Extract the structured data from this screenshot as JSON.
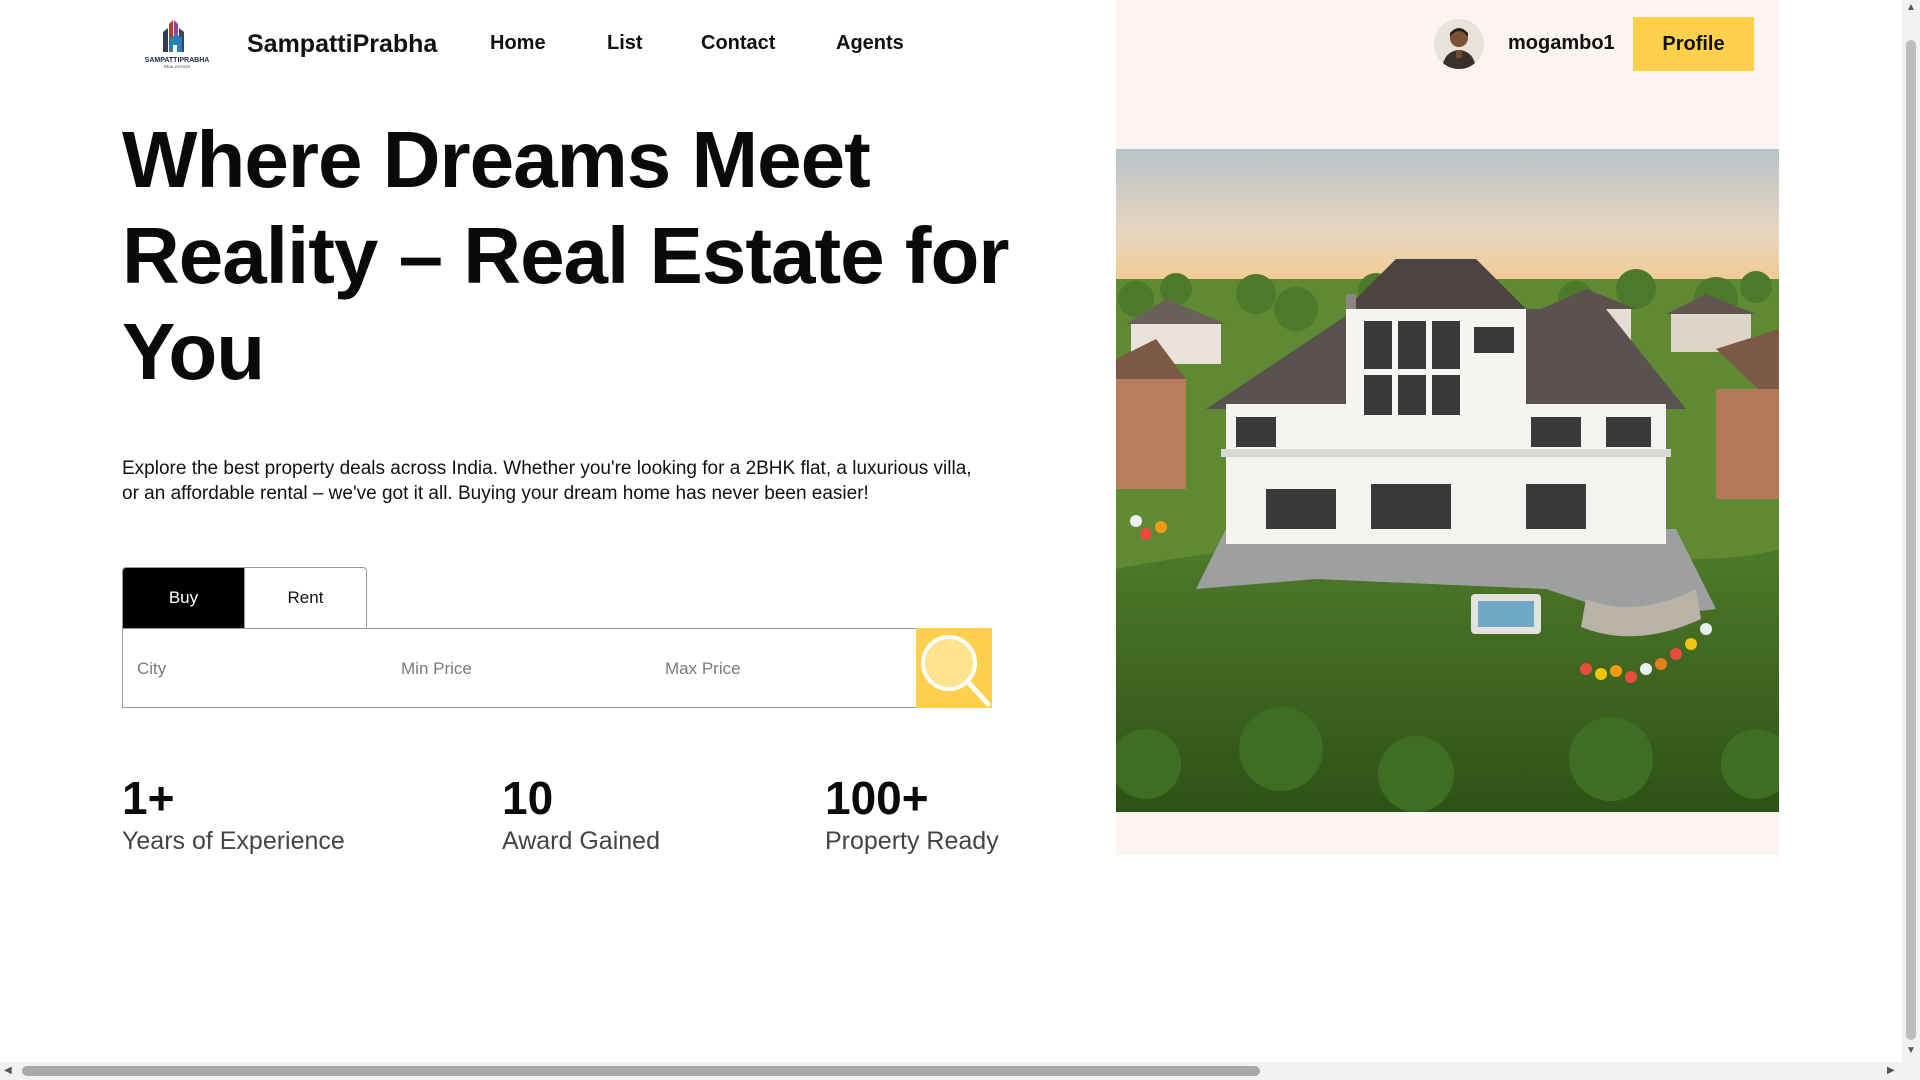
{
  "header": {
    "brand": "SampattiPrabha",
    "logo_text": "SAMPATTIPRABHA",
    "logo_subtext": "REAL ESTATE",
    "nav": [
      "Home",
      "List",
      "Contact",
      "Agents"
    ],
    "username": "mogambo1",
    "profile_label": "Profile"
  },
  "hero": {
    "title": "Where Dreams Meet Reality – Real Estate for You",
    "description": "Explore the best property deals across India. Whether you're looking for a 2BHK flat, a luxurious villa, or an affordable rental – we've got it all. Buying your dream home has never been easier!"
  },
  "search": {
    "tabs": [
      "Buy",
      "Rent"
    ],
    "active_tab": "Buy",
    "city_placeholder": "City",
    "min_price_placeholder": "Min Price",
    "max_price_placeholder": "Max Price",
    "button_icon": "search-icon"
  },
  "stats": [
    {
      "value": "1+",
      "label": "Years of Experience"
    },
    {
      "value": "10",
      "label": "Award Gained"
    },
    {
      "value": "100+",
      "label": "Property Ready"
    }
  ],
  "colors": {
    "accent": "#fed04b",
    "panel_bg": "#fcf4f1",
    "active_tab": "#000000"
  }
}
